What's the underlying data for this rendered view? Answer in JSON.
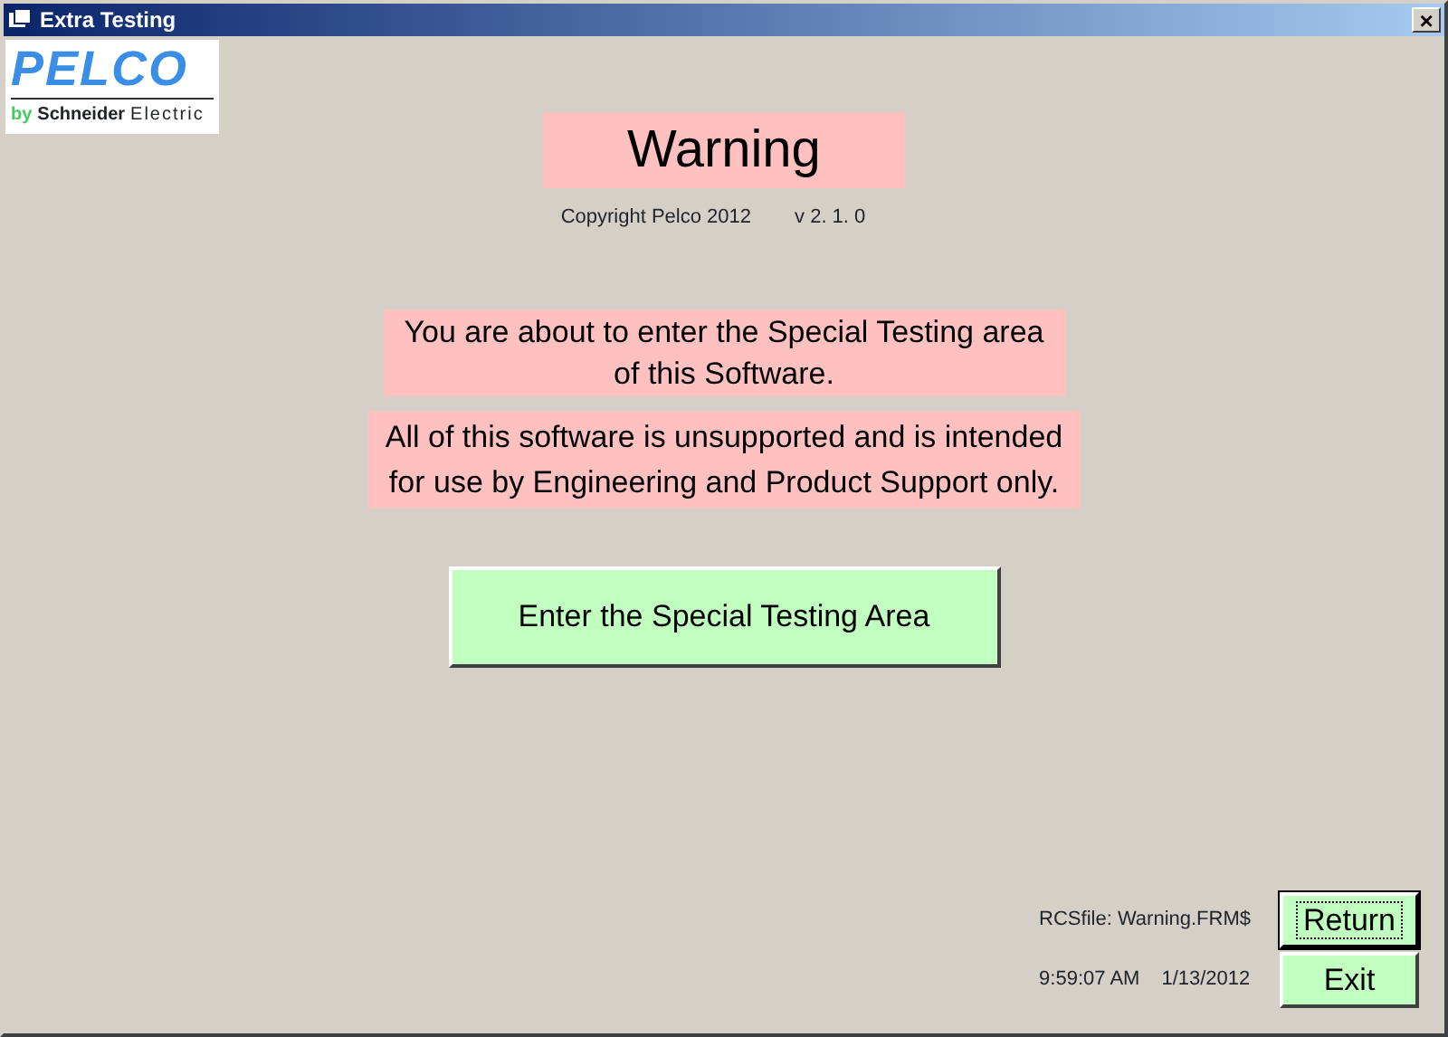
{
  "window": {
    "title": "Extra Testing",
    "close": "×"
  },
  "logo": {
    "brand": "PELCO",
    "by": "by",
    "company": "Schneider",
    "division": "Electric"
  },
  "heading": "Warning",
  "copyright": "Copyright Pelco 2012",
  "version": "v 2. 1. 0",
  "messages": [
    "You are about to enter the Special Testing area of this Software.",
    "All of this software is unsupported and is intended for use by Engineering and Product Support only."
  ],
  "enter_button": "Enter the Special Testing Area",
  "rcs_file": "RCSfile: Warning.FRM$",
  "time": "9:59:07 AM",
  "date": "1/13/2012",
  "buttons": [
    {
      "label": "Return",
      "focused": true
    },
    {
      "label": "Exit",
      "focused": false
    }
  ]
}
